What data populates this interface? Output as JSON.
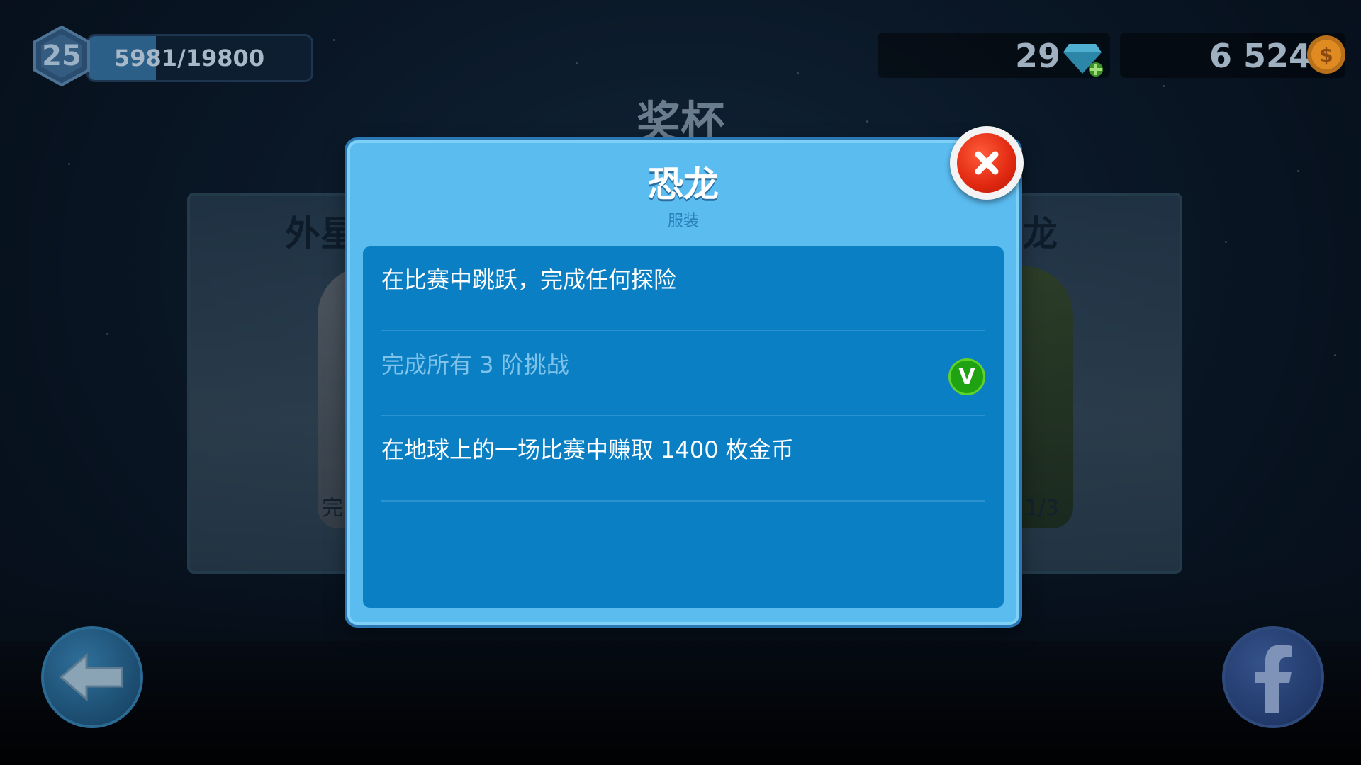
{
  "hud": {
    "level": "25",
    "xp_text": "5981/19800",
    "xp_progress": 0.302,
    "gems": "29",
    "coins": "6 524"
  },
  "screen": {
    "title": "奖杯"
  },
  "background_cards": {
    "left": {
      "title": "外星",
      "footer": "完"
    },
    "right": {
      "title": "龙",
      "footer": "度 1/3"
    }
  },
  "modal": {
    "title": "恐龙",
    "subtitle": "服装",
    "tasks": [
      {
        "label": "在比赛中跳跃，完成任何探险",
        "completed": false
      },
      {
        "label": "完成所有 3 阶挑战",
        "completed": true
      },
      {
        "label": "在地球上的一场比赛中赚取 1400 枚金币",
        "completed": false
      }
    ]
  },
  "icons": {
    "close": "close-icon",
    "check": "checkmark-icon",
    "gem": "diamond-icon",
    "coin": "coin-icon",
    "back": "back-arrow-icon",
    "facebook": "facebook-icon"
  },
  "colors": {
    "modal_bg": "#5bbcf0",
    "modal_body": "#0a7fc3",
    "close_red": "#e02810",
    "check_green": "#1fa313"
  }
}
